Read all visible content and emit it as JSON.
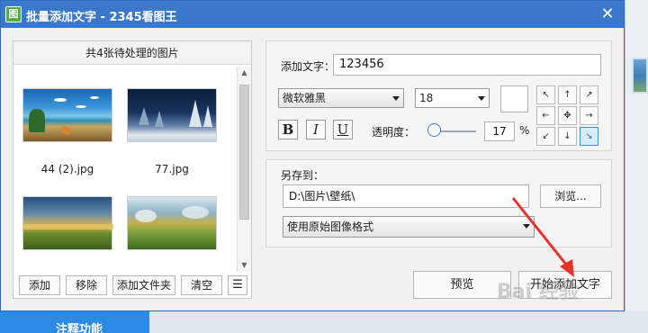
{
  "window": {
    "app_icon_glyph": "图",
    "title": "批量添加文字 - 2345看图王",
    "close_glyph": "✕"
  },
  "image_list": {
    "header": "共4张待处理的图片",
    "items": [
      {
        "caption": "44 (2).jpg"
      },
      {
        "caption": "77.jpg"
      },
      {
        "caption": ""
      },
      {
        "caption": ""
      }
    ],
    "buttons": {
      "add": "添加",
      "remove": "移除",
      "add_folder": "添加文件夹",
      "clear": "清空",
      "list_view": "☰"
    }
  },
  "text_settings": {
    "text_label": "添加文字：",
    "text_value": "123456",
    "font": "微软雅黑",
    "size": "18",
    "bold": "B",
    "italic": "I",
    "underline": "U",
    "opacity_label": "透明度：",
    "opacity_value": "17",
    "opacity_fraction": 0.17,
    "opacity_unit": "%",
    "position_selected": "bottom-right"
  },
  "save_settings": {
    "save_to_label": "另存到：",
    "path": "D:\\图片\\壁纸\\",
    "browse": "浏览...",
    "format": "使用原始图像格式"
  },
  "actions": {
    "preview": "预览",
    "start": "开始添加文字"
  },
  "background": {
    "banner_text": "注释功能",
    "watermark_text": "Bai 经验"
  },
  "colors": {
    "titlebar": "#3a78cc",
    "accent": "#3b8ee0",
    "arrow": "#e8312a"
  }
}
